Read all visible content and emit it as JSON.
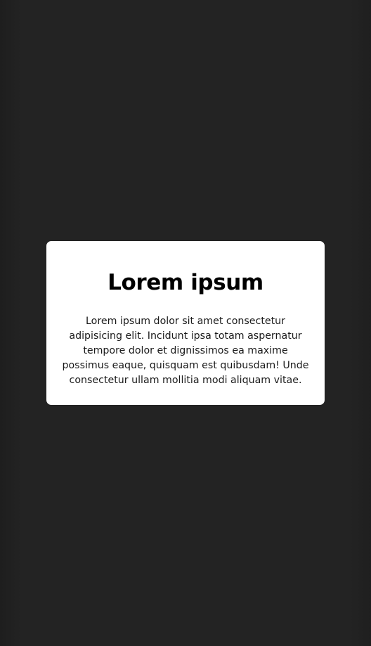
{
  "card": {
    "title": "Lorem ipsum",
    "body": "Lorem ipsum dolor sit amet consectetur adipisicing elit. Incidunt ipsa totam aspernatur tempore dolor et dignissimos ea maxime possimus eaque, quisquam est quibusdam! Unde consectetur ullam mollitia modi aliquam vitae."
  },
  "colors": {
    "background": "#222222",
    "card": "#ffffff",
    "text": "#000000"
  }
}
